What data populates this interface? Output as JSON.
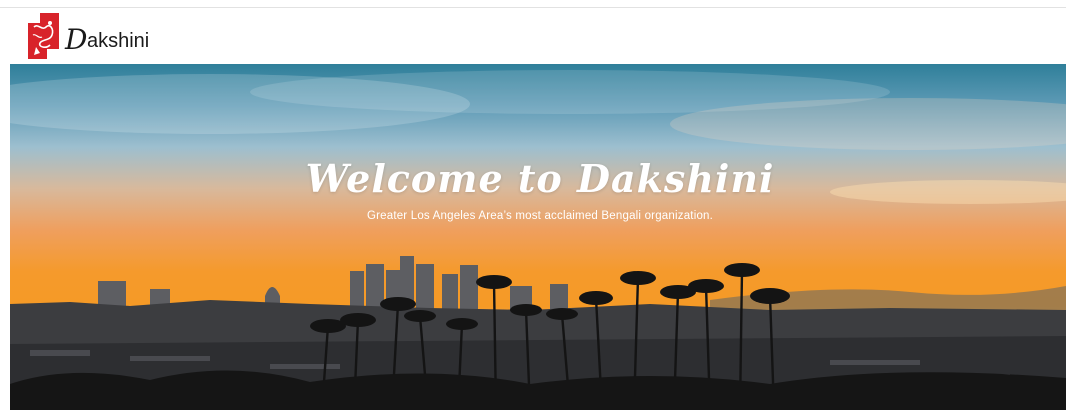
{
  "brand": {
    "logo_word_initial": "D",
    "logo_word_rest": "akshini",
    "colors": {
      "logo_red": "#d8232a",
      "text_dark": "#1a1a1a"
    }
  },
  "hero": {
    "title": "Welcome to Dakshini",
    "subtitle": "Greater Los Angeles Area’s most acclaimed Bengali organization.",
    "colors": {
      "sky_top": "#2f7f9a",
      "sunset_orange": "#f59a2c",
      "title": "#ffffff"
    }
  },
  "icons": {
    "logo_mark": "dakshini-emblem-icon"
  }
}
